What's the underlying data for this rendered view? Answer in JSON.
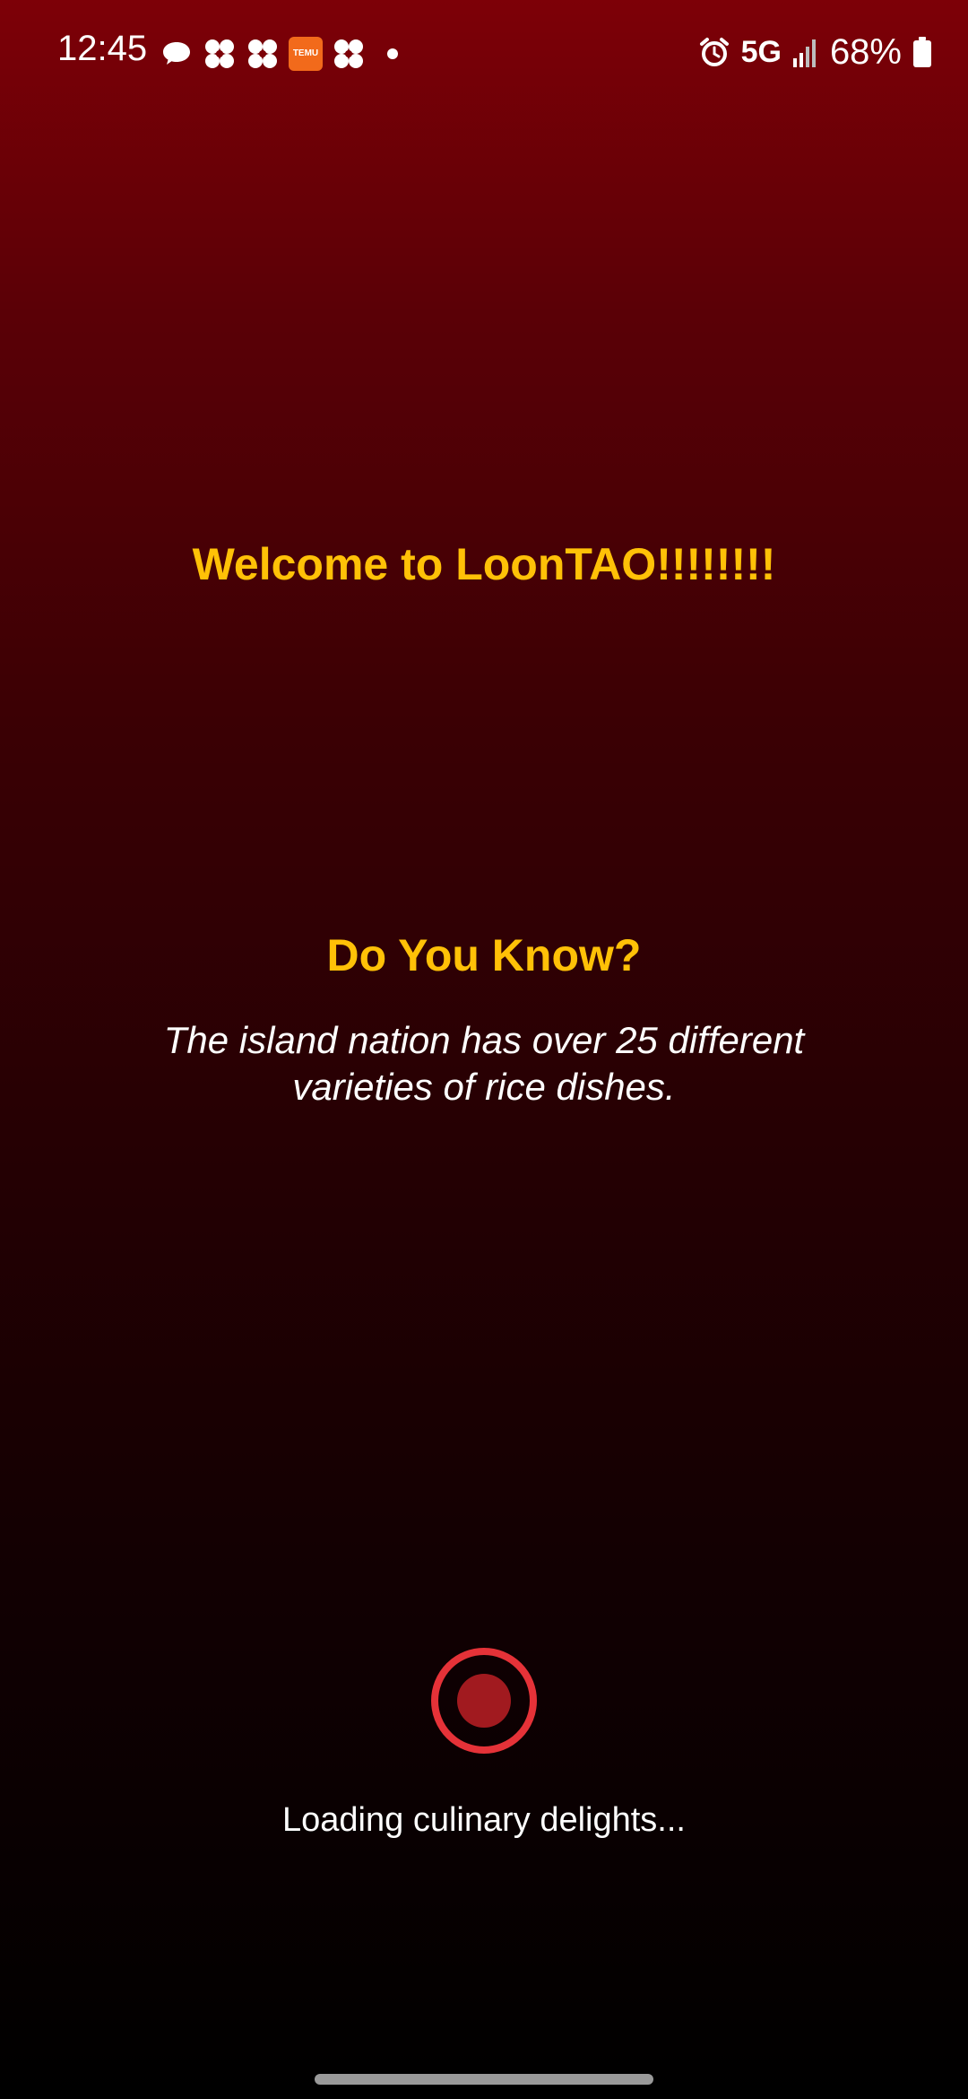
{
  "status_bar": {
    "time": "12:45",
    "network": "5G",
    "battery": "68%",
    "notification_icons": [
      "chat-bubble-icon",
      "clover-icon",
      "clover-icon",
      "temu-app-icon",
      "clover-icon",
      "more-dot-icon"
    ],
    "temu_label": "TEMU"
  },
  "splash": {
    "welcome": "Welcome to LoonTAO!!!!!!!!",
    "did_you_know_title": "Do You Know?",
    "fact": "The island nation has over 25 different varieties of rice dishes.",
    "loading": "Loading culinary delights..."
  },
  "colors": {
    "accent_yellow": "#ffc107",
    "gradient_top": "#7d0007",
    "gradient_bottom": "#000000",
    "loader_ring": "#e53238",
    "loader_core": "#a11a1f"
  }
}
